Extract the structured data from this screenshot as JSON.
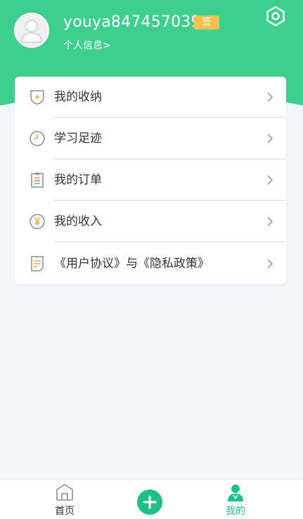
{
  "colors": {
    "brand": "#3ecf8e",
    "accent": "#1fbf89",
    "badge": "#f2c14e",
    "text": "#333333",
    "inactive_tab": "#333333",
    "active_tab": "#1fbf89"
  },
  "profile": {
    "username": "youya847457039",
    "sign_badge": "签",
    "profile_link": "个人信息>"
  },
  "header": {
    "settings_icon": "hexagon-gear-icon"
  },
  "menu": {
    "items": [
      {
        "label": "我的收纳",
        "icon": "shield-star-icon"
      },
      {
        "label": "学习足迹",
        "icon": "clock-icon"
      },
      {
        "label": "我的订单",
        "icon": "clipboard-list-icon"
      },
      {
        "label": "我的收入",
        "icon": "yuan-coin-icon"
      },
      {
        "label": "《用户协议》与《隐私政策》",
        "icon": "document-icon"
      }
    ]
  },
  "tabbar": {
    "home_label": "首页",
    "add_icon": "plus-icon",
    "mine_label": "我的"
  }
}
